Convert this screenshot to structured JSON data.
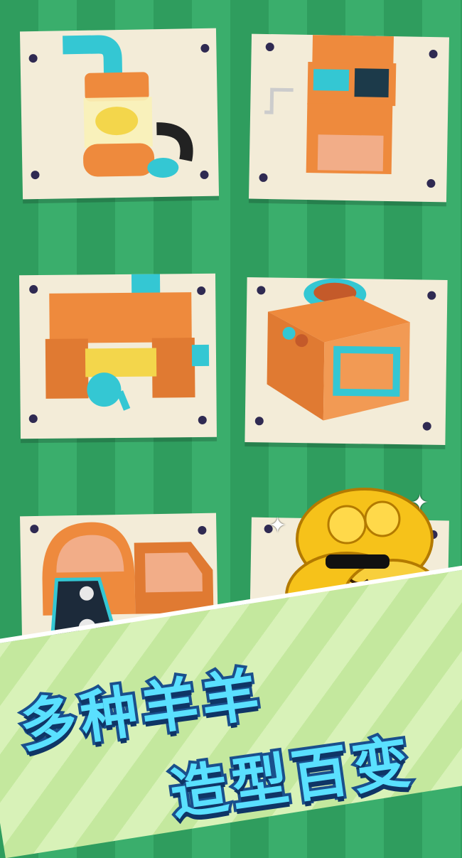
{
  "screen": {
    "background_colors": [
      "#2f9d5e",
      "#3aae6c"
    ],
    "cards": [
      {
        "machine": "vacuum-jar-machine",
        "icon": "vacuum-machine-icon"
      },
      {
        "machine": "control-panel-crank-machine",
        "icon": "control-panel-machine-icon"
      },
      {
        "machine": "roller-crank-machine",
        "icon": "roller-machine-icon"
      },
      {
        "machine": "fan-box-machine",
        "icon": "fan-box-machine-icon"
      },
      {
        "machine": "conveyor-oven-machine",
        "icon": "conveyor-oven-icon"
      },
      {
        "machine": "sheep-mascot-card",
        "icon": "golden-sheep-mascot-icon"
      }
    ]
  },
  "headline": {
    "line1": "多种羊羊",
    "line2": "造型百变",
    "fill_color": "#5ae0ff",
    "outline_color": "#1a4f8c"
  },
  "mascot": {
    "name": "golden-sheep-with-sunglasses",
    "color": "#f6c21a"
  }
}
